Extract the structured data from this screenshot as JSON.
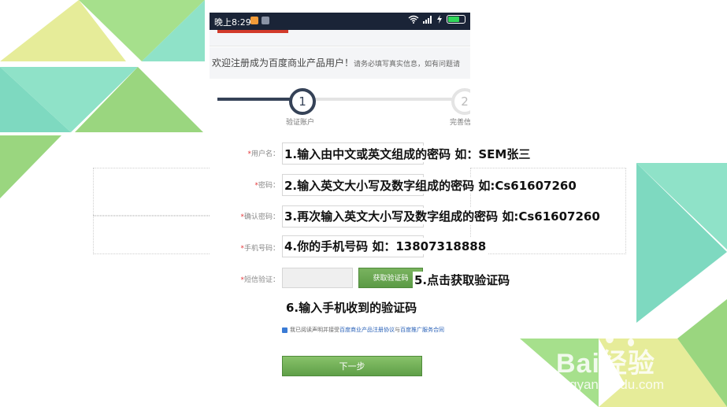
{
  "status_bar": {
    "time": "晚上8:29"
  },
  "page": {
    "welcome": "欢迎注册成为百度商业产品用户！",
    "welcome_note": "请务必填写真实信息，如有问题请",
    "steps": [
      {
        "number": "1",
        "label": "验证账户"
      },
      {
        "number": "2",
        "label": "完善信"
      }
    ]
  },
  "form": {
    "username_label": "用户名",
    "password_label": "密码",
    "confirm_label": "确认密码",
    "phone_label": "手机号码",
    "sms_label": "短信验证",
    "sms_button": "获取验证码",
    "agree_prefix": "我已阅读声明并接受",
    "agree_link1": "百度商业产品注册协议",
    "agree_mid": "与",
    "agree_link2": "百度推广服务合同",
    "next_button": "下一步"
  },
  "annotations": {
    "step1": "1.输入由中文或英文组成的密码      如：SEM张三",
    "step2": "2.输入英文大小写及数字组成的密码      如:Cs61607260",
    "step3": "3.再次输入英文大小写及数字组成的密码      如:Cs61607260",
    "step4": "4.你的手机号码      如：13807318888",
    "step5": "5.点击获取验证码",
    "step6": "6.输入手机收到的验证码"
  },
  "watermark": {
    "main": "Bai经验",
    "sub": "jingyan.baidu.com"
  },
  "colors": {
    "accent_green": "#5f9f48",
    "step_dark": "#354257",
    "required": "#e4393c"
  }
}
